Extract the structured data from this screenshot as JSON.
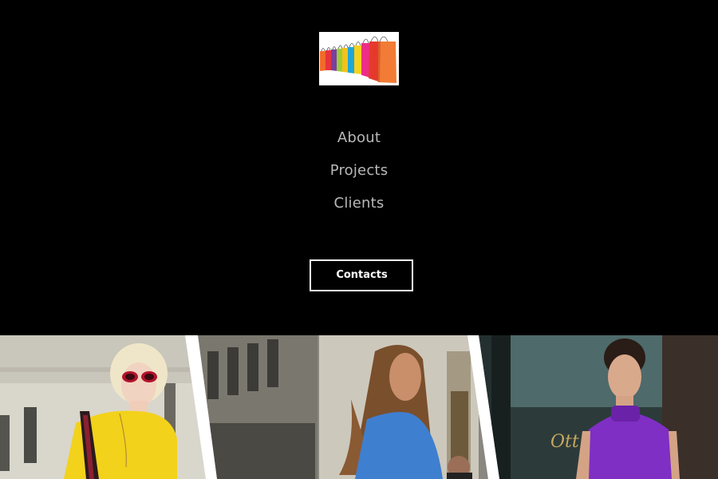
{
  "logo": {
    "icon": "shopping-bags-icon"
  },
  "nav": {
    "items": [
      {
        "label": "About"
      },
      {
        "label": "Projects"
      },
      {
        "label": "Clients"
      }
    ]
  },
  "cta": {
    "label": "Contacts"
  },
  "gallery": {
    "photos": [
      {
        "subject": "woman-yellow-sweater"
      },
      {
        "subject": "woman-blue-top"
      },
      {
        "subject": "woman-purple-dress"
      }
    ]
  },
  "colors": {
    "background": "#000000",
    "nav_text": "#b8b8b8",
    "button_border": "#ffffff",
    "button_text": "#ffffff"
  }
}
